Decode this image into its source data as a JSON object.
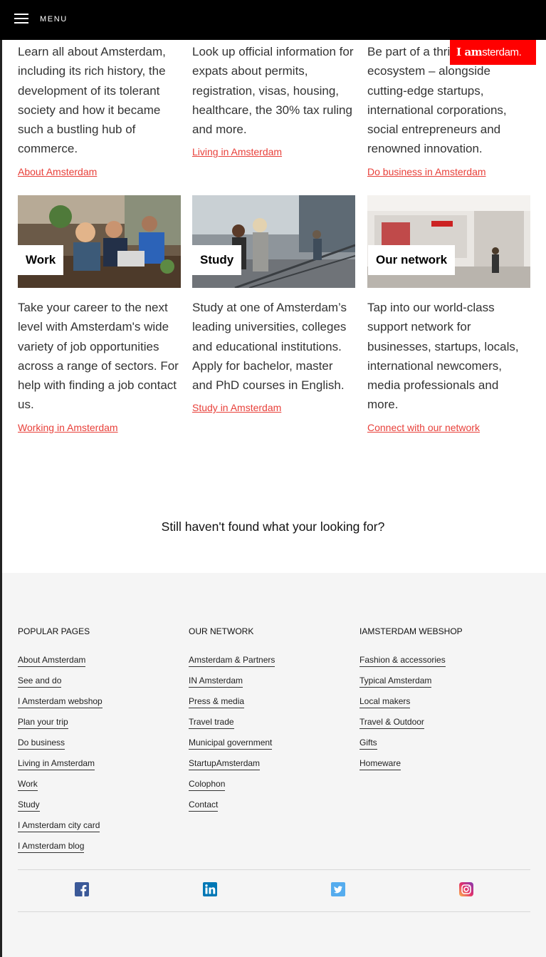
{
  "header": {
    "menu_label": "MENU",
    "logo_text_bold": "I am",
    "logo_text_rest": "sterdam."
  },
  "cards_top": [
    {
      "desc": "Learn all about Amsterdam, including its rich history, the development of its tolerant society and how it became such a bustling hub of commerce.",
      "link": "About Amsterdam"
    },
    {
      "desc": "Look up official information for expats about permits, registration, visas, housing, healthcare, the 30% tax ruling and more.",
      "link": "Living in Amsterdam"
    },
    {
      "desc": "Be part of a thriving ecosystem – alongside cutting-edge startups, international corporations, social entrepreneurs and renowned innovation.",
      "link": "Do business in Amsterdam"
    }
  ],
  "cards_bottom": [
    {
      "title": "Work",
      "desc": "Take your career to the next level with Amsterdam's wide variety of job opportunities across a range of sectors. For help with finding a job contact us.",
      "link": "Working in Amsterdam"
    },
    {
      "title": "Study",
      "desc": "Study at one of Amsterdam’s leading universities, colleges and educational institutions. Apply for bachelor, master and PhD courses in English.",
      "link": "Study in Amsterdam"
    },
    {
      "title": "Our network",
      "desc": "Tap into our world-class support network for businesses, startups, locals, international newcomers, media professionals and more.",
      "link": "Connect with our network"
    }
  ],
  "still_text": "Still haven't found what your looking for?",
  "footer": {
    "popular": {
      "heading": "POPULAR PAGES",
      "links": [
        "About Amsterdam",
        "See and do",
        "I Amsterdam webshop",
        "Plan your trip",
        "Do business",
        "Living in Amsterdam",
        "Work",
        "Study",
        "I Amsterdam city card",
        "I Amsterdam blog"
      ]
    },
    "network": {
      "heading": "OUR NETWORK",
      "links": [
        "Amsterdam & Partners",
        "IN Amsterdam",
        "Press & media",
        "Travel trade",
        "Municipal government",
        "StartupAmsterdam",
        "Colophon",
        "Contact"
      ]
    },
    "webshop": {
      "heading": "IAMSTERDAM WEBSHOP",
      "links": [
        "Fashion & accessories",
        "Typical Amsterdam",
        "Local makers",
        "Travel & Outdoor",
        "Gifts",
        "Homeware"
      ]
    }
  },
  "social": [
    "facebook-icon",
    "linkedin-icon",
    "twitter-icon",
    "instagram-icon"
  ],
  "colors": {
    "accent_red": "#ff0000",
    "link_red": "#e8403a",
    "footer_bg": "#f5f5f5"
  }
}
